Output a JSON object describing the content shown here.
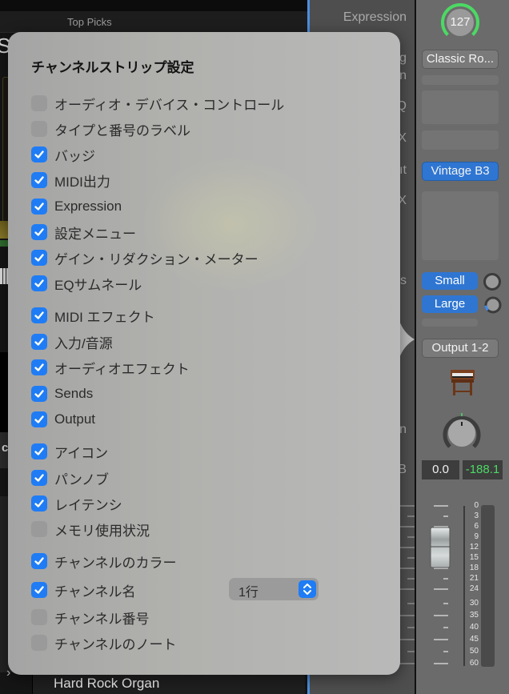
{
  "background": {
    "library_header": "Top Picks",
    "partial_heading_glyph": "S",
    "partial_mid_glyph": "c",
    "bottom_item_label": "Hard Rock Organ",
    "bottom_chevron": "chevron-right-icon"
  },
  "label_column": {
    "labels": [
      "Expression",
      "g",
      "n",
      "Q",
      "X",
      "ıt",
      "X",
      "s",
      "n",
      "B"
    ]
  },
  "channel_strip": {
    "expression_value": "127",
    "expression_color": "#4cd964",
    "setting_button": "Classic Ro...",
    "instrument_button": "Vintage B3",
    "sends": [
      {
        "label": "Small",
        "level": 0
      },
      {
        "label": "Large",
        "level": 0.15
      }
    ],
    "output_button": "Output 1-2",
    "icon": "organ-icon",
    "volume_readout": "0.0",
    "peak_readout": "-188.1",
    "peak_color": "#4cd964",
    "fader_scale": [
      "0",
      "3",
      "6",
      "9",
      "12",
      "15",
      "18",
      "21",
      "24",
      "30",
      "35",
      "40",
      "45",
      "50",
      "60"
    ]
  },
  "popover": {
    "title": "チャンネルストリップ設定",
    "options": [
      {
        "label": "オーディオ・デバイス・コントロール",
        "checked": false
      },
      {
        "label": "タイプと番号のラベル",
        "checked": false
      },
      {
        "label": "バッジ",
        "checked": true
      },
      {
        "label": "MIDI出力",
        "checked": true
      },
      {
        "label": "Expression",
        "checked": true
      },
      {
        "label": "設定メニュー",
        "checked": true
      },
      {
        "label": "ゲイン・リダクション・メーター",
        "checked": true
      },
      {
        "label": "EQサムネール",
        "checked": true
      },
      {
        "label": "MIDI エフェクト",
        "checked": true
      },
      {
        "label": "入力/音源",
        "checked": true
      },
      {
        "label": "オーディオエフェクト",
        "checked": true
      },
      {
        "label": "Sends",
        "checked": true
      },
      {
        "label": "Output",
        "checked": true
      },
      {
        "label": "アイコン",
        "checked": true
      },
      {
        "label": "パンノブ",
        "checked": true
      },
      {
        "label": "レイテンシ",
        "checked": true
      },
      {
        "label": "メモリ使用状況",
        "checked": false
      },
      {
        "label": "チャンネルのカラー",
        "checked": true
      },
      {
        "label": "チャンネル名",
        "checked": true
      },
      {
        "label": "チャンネル番号",
        "checked": false
      },
      {
        "label": "チャンネルのノート",
        "checked": false
      }
    ],
    "channel_name_lines": {
      "selected": "1行"
    }
  }
}
